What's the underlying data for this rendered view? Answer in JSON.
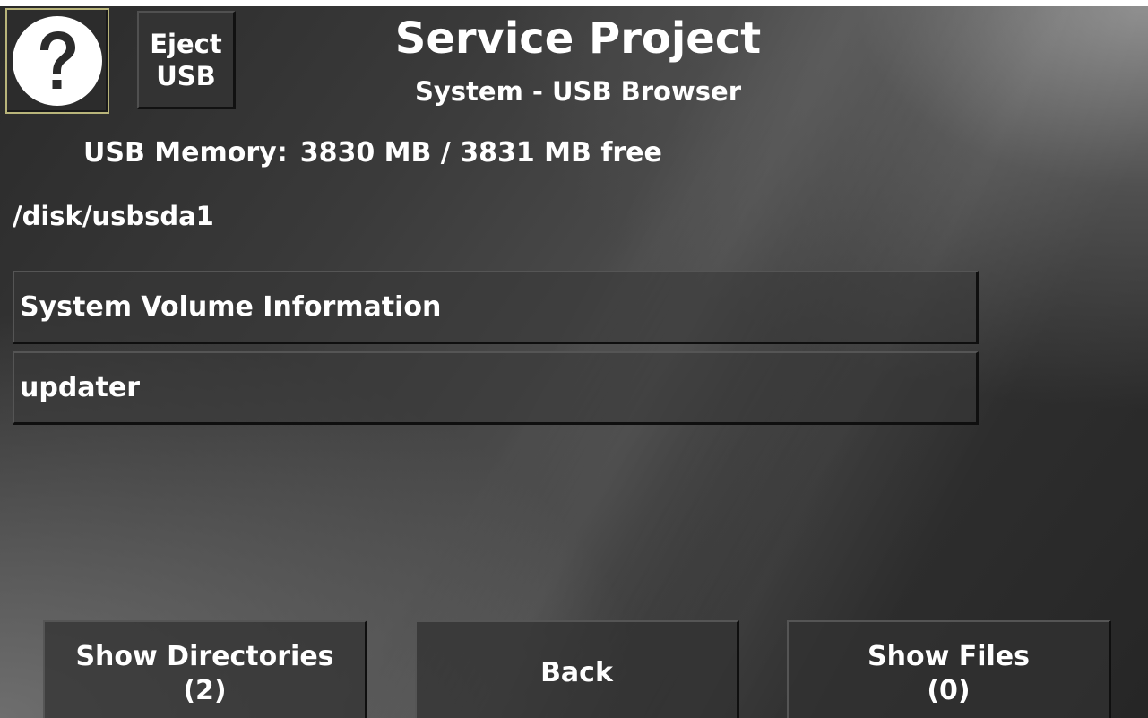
{
  "header": {
    "title": "Service Project",
    "subtitle": "System - USB Browser",
    "help_icon": "question-mark-icon",
    "eject_label": "Eject\nUSB"
  },
  "memory": {
    "label": "USB Memory:",
    "value": "3830 MB / 3831 MB free"
  },
  "path": "/disk/usbsda1",
  "entries": [
    {
      "label": "System Volume Information"
    },
    {
      "label": "updater"
    }
  ],
  "footer": {
    "show_directories": {
      "label": "Show Directories",
      "count": "(2)"
    },
    "back": {
      "label": "Back"
    },
    "show_files": {
      "label": "Show Files",
      "count": "(0)"
    }
  }
}
